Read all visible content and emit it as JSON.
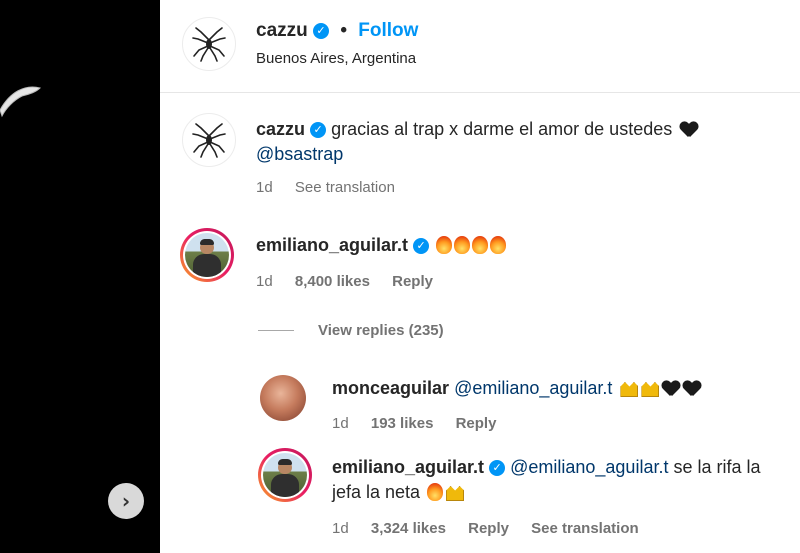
{
  "media": {
    "next_icon": "›"
  },
  "post_header": {
    "username": "cazzu",
    "verified_glyph": "✓",
    "separator": "•",
    "follow_label": "Follow",
    "location": "Buenos Aires, Argentina"
  },
  "caption": {
    "username": "cazzu",
    "text": "gracias al trap x darme el amor de ustedes",
    "mention": "@bsastrap",
    "time": "1d",
    "see_translation": "See translation"
  },
  "comments": [
    {
      "username": "emiliano_aguilar.t",
      "time": "1d",
      "likes": "8,400 likes",
      "reply": "Reply"
    }
  ],
  "view_replies": "View replies (235)",
  "replies": [
    {
      "username": "monceaguilar",
      "mention": "@emiliano_aguilar.t",
      "time": "1d",
      "likes": "193 likes",
      "reply": "Reply"
    },
    {
      "username": "emiliano_aguilar.t",
      "mention": "@emiliano_aguilar.t",
      "text_a": "se la rifa la",
      "text_b": "jefa la neta",
      "time": "1d",
      "likes": "3,324 likes",
      "reply": "Reply",
      "see_translation": "See translation"
    }
  ],
  "icons": [
    "spider-avatar-icon",
    "verified-badge-icon",
    "fire-emoji-icon",
    "black-heart-emoji-icon",
    "crown-emoji-icon",
    "chevron-right-icon"
  ],
  "colors": {
    "link_blue": "#0095f6",
    "mention_blue": "#00376b",
    "muted": "#737373",
    "verified": "#0095f6"
  }
}
